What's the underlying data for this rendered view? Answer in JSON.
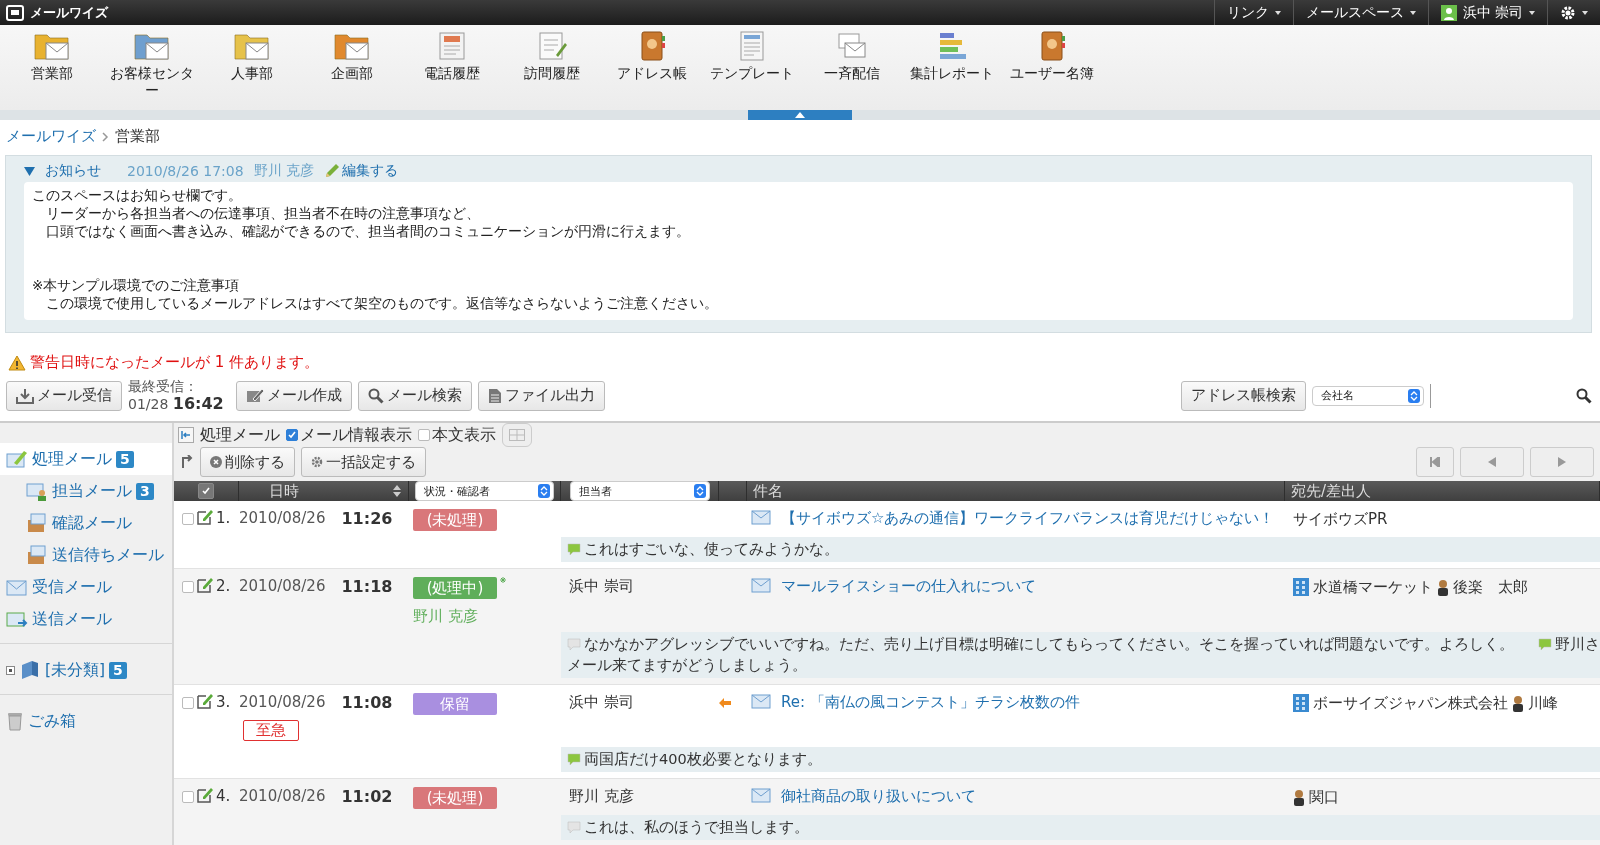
{
  "top_bar": {
    "app_name": "メールワイズ",
    "menus": [
      {
        "label": "リンク"
      },
      {
        "label": "メールスペース"
      }
    ],
    "user": "浜中 崇司"
  },
  "app_icons": [
    {
      "label": "営業部",
      "kind": "folder",
      "color": "#e8b230"
    },
    {
      "label": "お客様センター",
      "kind": "folder",
      "color": "#6f9fcf"
    },
    {
      "label": "人事部",
      "kind": "folder",
      "color": "#e6c24a"
    },
    {
      "label": "企画部",
      "kind": "folder",
      "color": "#e0892e"
    },
    {
      "label": "電話履歴",
      "kind": "log"
    },
    {
      "label": "訪問履歴",
      "kind": "notepad"
    },
    {
      "label": "アドレス帳",
      "kind": "book"
    },
    {
      "label": "テンプレート",
      "kind": "template"
    },
    {
      "label": "一斉配信",
      "kind": "broadcast"
    },
    {
      "label": "集計レポート",
      "kind": "report"
    },
    {
      "label": "ユーザー名簿",
      "kind": "book"
    }
  ],
  "breadcrumb": [
    {
      "label": "メールワイズ"
    },
    {
      "label": "営業部"
    }
  ],
  "notice": {
    "title": "お知らせ",
    "expanded": true,
    "date": "2010/8/26 17:08",
    "author": "野川 克彦",
    "edit": "編集する",
    "paragraphs": [
      [
        "このスペースはお知らせ欄です。",
        "　リーダーから各担当者への伝達事項、担当者不在時の注意事項など、",
        "　口頭ではなく画面へ書き込み、確認ができるので、担当者間のコミュニケーションが円滑に行えます。"
      ],
      [
        "※本サンプル環境でのご注意事項",
        "　この環境で使用しているメールアドレスはすべて架空のものです。返信等なさらないようご注意ください。"
      ]
    ]
  },
  "warning": "警告日時になったメールが 1 件あります。",
  "toolbar": {
    "receive": "メール受信",
    "last_label": "最終受信：",
    "last_date": "01/28",
    "last_time": "16:42",
    "buttons": [
      {
        "label": "メール作成",
        "kind": "compose"
      },
      {
        "label": "メール検索",
        "kind": "search"
      },
      {
        "label": "ファイル出力",
        "kind": "export"
      }
    ],
    "address_search": "アドレス帳検索",
    "address_field": "会社名"
  },
  "sidebar": {
    "groups": [
      [
        {
          "label": "処理メール",
          "count": "5",
          "selected": true,
          "kind": "process",
          "children": [
            {
              "label": "担当メール",
              "count": "3",
              "selected": false,
              "kind": "assigned"
            },
            {
              "label": "確認メール",
              "selected": false,
              "kind": "box"
            },
            {
              "label": "送信待ちメール",
              "selected": false,
              "kind": "box"
            }
          ]
        },
        {
          "label": "受信メール",
          "selected": false,
          "kind": "inbox"
        },
        {
          "label": "送信メール",
          "selected": false,
          "kind": "sent"
        }
      ],
      [
        {
          "label": "[未分類]",
          "count": "5",
          "selected": false,
          "kind": "category",
          "expanded": false
        }
      ],
      [
        {
          "label": "ごみ箱",
          "selected": false,
          "kind": "trash"
        }
      ]
    ]
  },
  "view_bar": {
    "title": "処理メール",
    "options": [
      {
        "label": "メール情報表示",
        "checked": true
      },
      {
        "label": "本文表示",
        "checked": false
      }
    ]
  },
  "actions": [
    {
      "label": "削除する",
      "kind": "delete"
    },
    {
      "label": "一括設定する",
      "kind": "settings"
    }
  ],
  "table": {
    "select_all": true,
    "columns": {
      "date": "日時",
      "status": "状況・確認者",
      "assignee": "担当者",
      "subject": "件名",
      "recipient": "宛先/差出人"
    },
    "rows": [
      {
        "number": "1.",
        "checked": false,
        "date": "2010/08/26",
        "time": "11:26",
        "status": {
          "label": "(未処理)",
          "color": "#d9777a"
        },
        "flagged": false,
        "subject": "【サイボウズ☆あみの通信】ワークライフバランスは育児だけじゃない！",
        "forwarded": false,
        "recipients": [
          {
            "kind": "text",
            "name": "サイボウズPR"
          }
        ],
        "comments": [
          {
            "text": "これはすごいな、使ってみようかな。",
            "color": "#8cc63f"
          }
        ]
      },
      {
        "number": "2.",
        "checked": false,
        "date": "2010/08/26",
        "time": "11:18",
        "status": {
          "label": "(処理中)",
          "color": "#5fae5a"
        },
        "flagged": true,
        "confirmer": "野川 克彦",
        "assignee": "浜中 崇司",
        "subject": "マールライスショーの仕入れについて",
        "forwarded": false,
        "recipients": [
          {
            "kind": "company",
            "name": "水道橋マーケット"
          },
          {
            "kind": "person",
            "name": "後楽　太郎"
          }
        ],
        "comments": [
          {
            "text": "なかなかアグレッシブでいいですね。ただ、売り上げ目標は明確にしてもらってください。そこを握っていれば問題ないです。よろしく。",
            "color": "#e4e4e4"
          },
          {
            "text": "野川さ",
            "color": "#8cc63f"
          }
        ],
        "continuation": "メール来てますがどうしましょう。"
      },
      {
        "number": "3.",
        "checked": false,
        "date": "2010/08/26",
        "time": "11:08",
        "status": {
          "label": "保留",
          "color": "#a98fe0"
        },
        "flagged": false,
        "urgent": "至急",
        "assignee": "浜中 崇司",
        "subject": "Re: 「南仏の風コンテスト」チラシ枚数の件",
        "forwarded": true,
        "recipients": [
          {
            "kind": "company",
            "name": "ボーサイズジャパン株式会社"
          },
          {
            "kind": "person",
            "name": "川峰"
          }
        ],
        "comments": [
          {
            "text": "両国店だけ400枚必要となります。",
            "color": "#8cc63f"
          }
        ]
      },
      {
        "number": "4.",
        "checked": false,
        "date": "2010/08/26",
        "time": "11:02",
        "status": {
          "label": "(未処理)",
          "color": "#d9777a"
        },
        "flagged": false,
        "assignee": "野川 克彦",
        "subject": "御社商品の取り扱いについて",
        "forwarded": false,
        "recipients": [
          {
            "kind": "person",
            "name": "関口"
          }
        ],
        "comments": [
          {
            "text": "これは、私のほうで担当します。",
            "color": "#e4e4e4"
          }
        ]
      }
    ]
  }
}
